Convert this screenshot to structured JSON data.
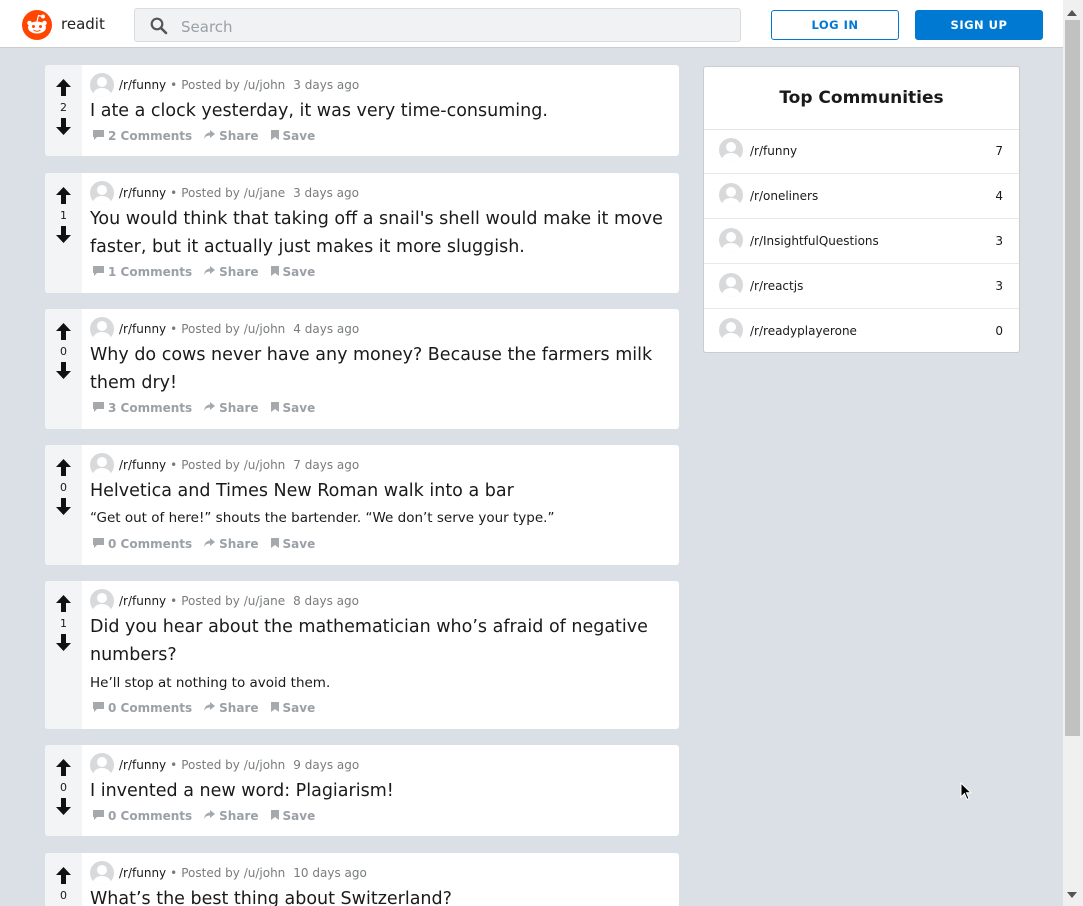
{
  "header": {
    "brand": "readit",
    "search_placeholder": "Search",
    "login_label": "LOG IN",
    "signup_label": "SIGN UP"
  },
  "posts": [
    {
      "score": "2",
      "subreddit": "/r/funny",
      "posted_by": "Posted by /u/john",
      "time": "3 days ago",
      "title": "I ate a clock yesterday, it was very time-consuming.",
      "body": "",
      "comments": "2 Comments"
    },
    {
      "score": "1",
      "subreddit": "/r/funny",
      "posted_by": "Posted by /u/jane",
      "time": "3 days ago",
      "title": "You would think that taking off a snail's shell would make it move faster, but it actually just makes it more sluggish.",
      "body": "",
      "comments": "1 Comments"
    },
    {
      "score": "0",
      "subreddit": "/r/funny",
      "posted_by": "Posted by /u/john",
      "time": "4 days ago",
      "title": "Why do cows never have any money? Because the farmers milk them dry!",
      "body": "",
      "comments": "3 Comments"
    },
    {
      "score": "0",
      "subreddit": "/r/funny",
      "posted_by": "Posted by /u/john",
      "time": "7 days ago",
      "title": "Helvetica and Times New Roman walk into a bar",
      "body": "“Get out of here!” shouts the bartender. “We don’t serve your type.”",
      "comments": "0 Comments"
    },
    {
      "score": "1",
      "subreddit": "/r/funny",
      "posted_by": "Posted by /u/jane",
      "time": "8 days ago",
      "title": "Did you hear about the mathematician who’s afraid of negative numbers?",
      "body": "He’ll stop at nothing to avoid them.",
      "comments": "0 Comments"
    },
    {
      "score": "0",
      "subreddit": "/r/funny",
      "posted_by": "Posted by /u/john",
      "time": "9 days ago",
      "title": "I invented a new word: Plagiarism!",
      "body": "",
      "comments": "0 Comments"
    },
    {
      "score": "0",
      "subreddit": "/r/funny",
      "posted_by": "Posted by /u/john",
      "time": "10 days ago",
      "title": "What’s the best thing about Switzerland?",
      "body": "",
      "comments": ""
    }
  ],
  "post_actions": {
    "share": "Share",
    "save": "Save"
  },
  "sidebar": {
    "title": "Top Communities",
    "communities": [
      {
        "name": "/r/funny",
        "count": "7"
      },
      {
        "name": "/r/oneliners",
        "count": "4"
      },
      {
        "name": "/r/InsightfulQuestions",
        "count": "3"
      },
      {
        "name": "/r/reactjs",
        "count": "3"
      },
      {
        "name": "/r/readyplayerone",
        "count": "0"
      }
    ]
  },
  "colors": {
    "brand": "#ff4500",
    "accent": "#0079d3",
    "background": "#dae0e6"
  },
  "icons": [
    "reddit-logo-icon",
    "search-icon",
    "upvote-arrow-icon",
    "downvote-arrow-icon",
    "comment-icon",
    "share-icon",
    "bookmark-icon",
    "user-avatar-icon",
    "mouse-cursor-icon"
  ]
}
